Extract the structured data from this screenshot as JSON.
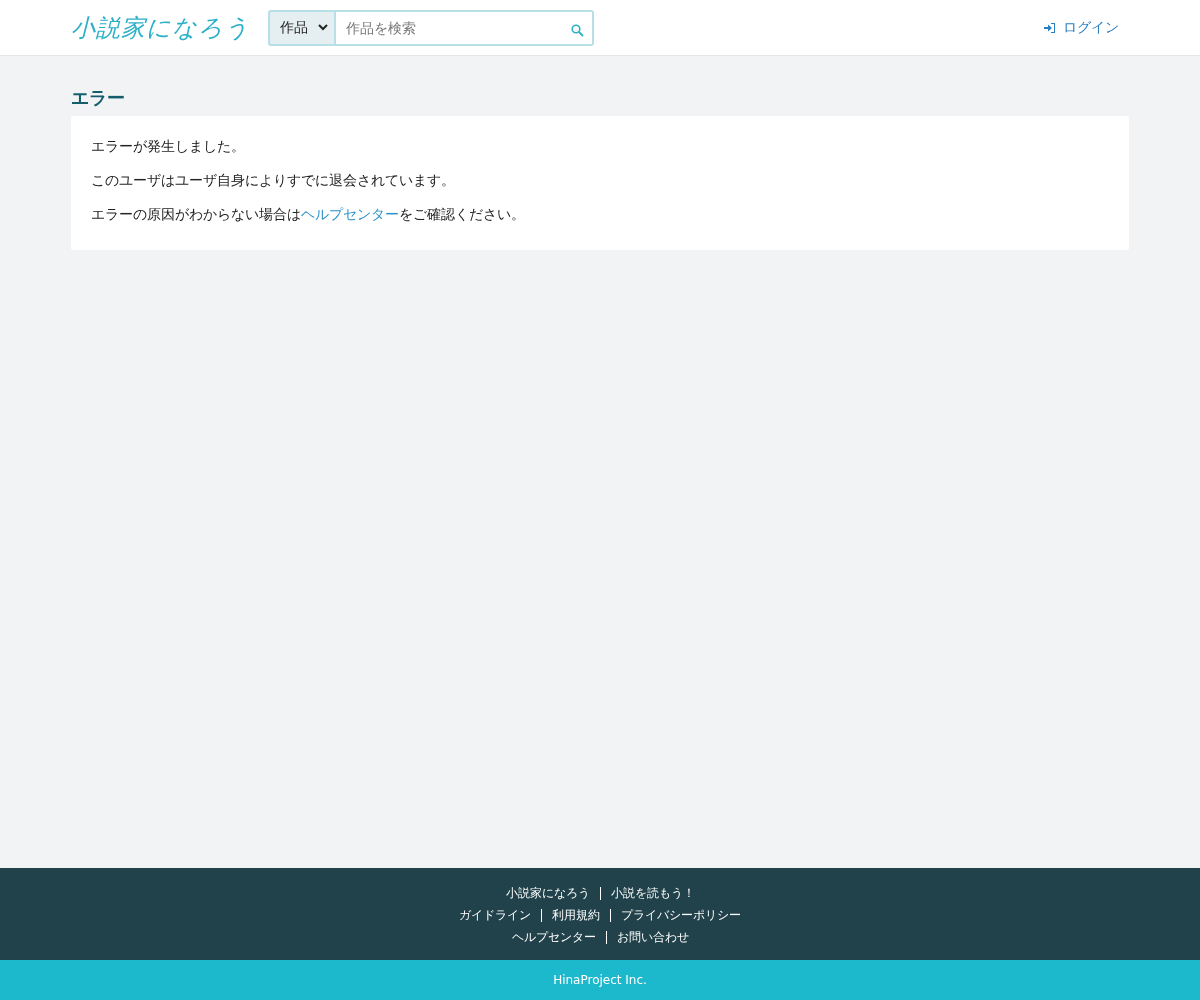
{
  "header": {
    "logo": "小説家になろう",
    "search": {
      "category": "作品",
      "placeholder": "作品を検索"
    },
    "login": "ログイン"
  },
  "page": {
    "title": "エラー",
    "paragraphs": [
      {
        "kind": "text",
        "text": "エラーが発生しました。"
      },
      {
        "kind": "text",
        "text": "このユーザはユーザ自身によりすでに退会されています。"
      },
      {
        "kind": "link",
        "before": "エラーの原因がわからない場合は",
        "link": "ヘルプセンター",
        "after": "をご確認ください。"
      }
    ]
  },
  "footer": {
    "link_rows": [
      [
        "小説家になろう",
        "小説を読もう！"
      ],
      [
        "ガイドライン",
        "利用規約",
        "プライバシーポリシー"
      ],
      [
        "ヘルプセンター",
        "お問い合わせ"
      ]
    ],
    "copyright": "HinaProject Inc."
  }
}
